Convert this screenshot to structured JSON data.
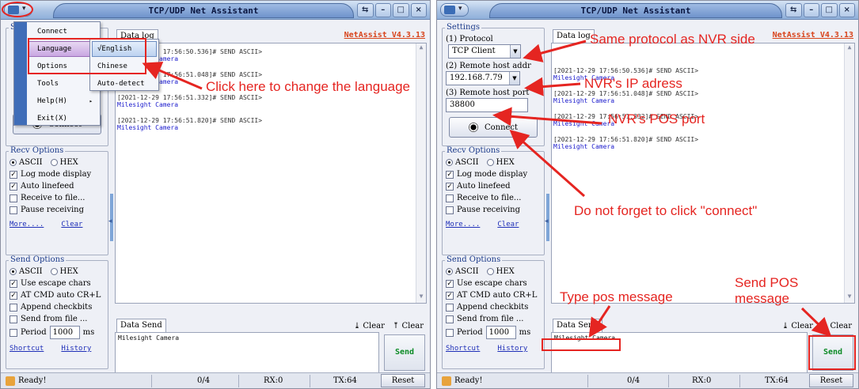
{
  "window_title": "TCP/UDP Net Assistant",
  "window_controls": [
    "⇆",
    "–",
    "□",
    "×"
  ],
  "brand": "NetAssist V4.3.13",
  "colors": {
    "annotation": "#e52521",
    "brand": "#d8431a",
    "send_label": "#0a8a24",
    "log_msg": "#1a1acc"
  },
  "tabs": {
    "data_log": "Data log",
    "data_send": "Data Send"
  },
  "settings": {
    "legend": "Settings",
    "protocol_label": "(1) Protocol",
    "protocol_value": "TCP Client",
    "host_label": "(2) Remote host addr",
    "host_value": "192.168.7.79",
    "port_label": "(3) Remote host port",
    "port_value": "38800",
    "connect": "Connect"
  },
  "recv_options": {
    "legend": "Recv Options",
    "ascii": "ASCII",
    "hex": "HEX",
    "log_mode": "Log mode display",
    "auto_linefeed": "Auto linefeed",
    "receive_to_file": "Receive to file...",
    "pause": "Pause receiving",
    "more": "More....",
    "clear": "Clear"
  },
  "send_options": {
    "legend": "Send Options",
    "ascii": "ASCII",
    "hex": "HEX",
    "escape": "Use escape chars",
    "at_cmd": "AT CMD auto CR+L",
    "append": "Append checkbits",
    "from_file": "Send from file ...",
    "period": "Period",
    "period_value": "1000",
    "period_unit": "ms",
    "shortcut": "Shortcut",
    "history": "History"
  },
  "log_entries": [
    {
      "header": "[2021-12-29 17:56:50.536]# SEND ASCII>",
      "msg": "Milesight Camera"
    },
    {
      "header": "[2021-12-29 17:56:51.048]# SEND ASCII>",
      "msg": "Milesight Camera"
    },
    {
      "header": "[2021-12-29 17:56:51.332]# SEND ASCII>",
      "msg": "Milesight Camera"
    },
    {
      "header": "[2021-12-29 17:56:51.820]# SEND ASCII>",
      "msg": "Milesight Camera"
    }
  ],
  "clear_recv": "Clear",
  "clear_send": "Clear",
  "send_text": "Milesight Camera",
  "send_button": "Send",
  "status": {
    "ready": "Ready!",
    "left_counter": "0/4",
    "right_counter": "0/4",
    "rx": "RX:0",
    "tx": "TX:64",
    "reset": "Reset"
  },
  "menu": {
    "items": [
      "Connect",
      "Language",
      "Options",
      "Tools",
      "Help(H)",
      "Exit(X)"
    ],
    "submenu": [
      "√English",
      "Chinese",
      "Auto-detect"
    ]
  },
  "annotations": {
    "language": "Click here to change the language",
    "protocol": "Same protocol as NVR side",
    "ip": "NVR's IP adress",
    "port": "NVR's POS port",
    "connect": "Do not forget to click \"connect\"",
    "type_msg": "Type pos message",
    "send_msg_line1": "Send POS",
    "send_msg_line2": "message"
  }
}
